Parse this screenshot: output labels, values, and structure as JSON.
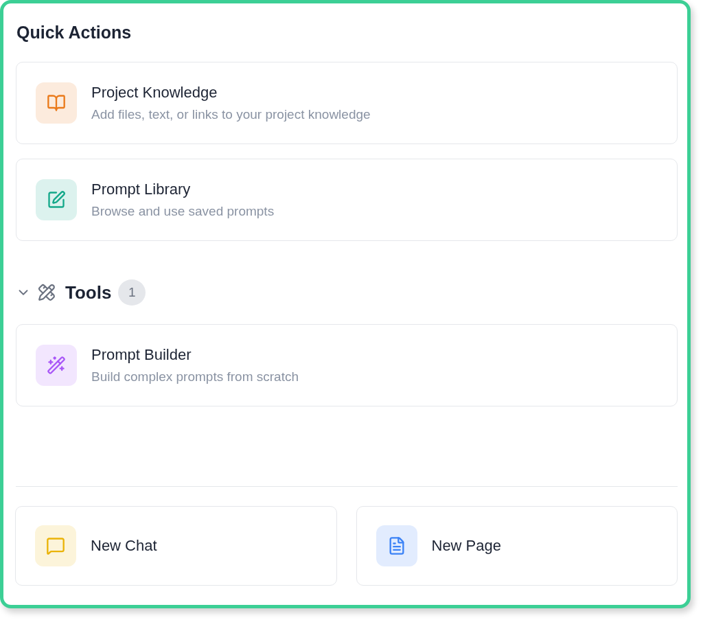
{
  "title": "Quick Actions",
  "quick_actions": [
    {
      "kind": "book",
      "color": "#ea7a1a",
      "title": "Project Knowledge",
      "description": "Add files, text, or links to your project knowledge"
    },
    {
      "kind": "edit",
      "color": "#14a88a",
      "title": "Prompt Library",
      "description": "Browse and use saved prompts"
    }
  ],
  "tools": {
    "label": "Tools",
    "count": "1",
    "expanded": true,
    "items": [
      {
        "kind": "wand",
        "color": "#a855f7",
        "title": "Prompt Builder",
        "description": "Build complex prompts from scratch"
      }
    ]
  },
  "footer_actions": [
    {
      "kind": "chat",
      "color": "#eab308",
      "title": "New Chat"
    },
    {
      "kind": "file",
      "color": "#3b82f6",
      "title": "New Page"
    }
  ]
}
